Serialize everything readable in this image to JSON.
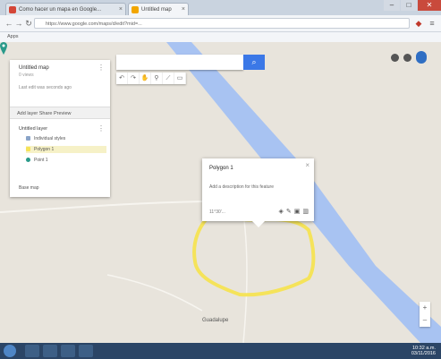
{
  "browser": {
    "tabs": [
      {
        "label": "Como hacer un mapa en Google...",
        "active": false,
        "favicon_color": "#d44638"
      },
      {
        "label": "Untitled map",
        "active": true,
        "favicon_color": "#f2a600"
      }
    ],
    "omnibox_text": "https://www.google.com/maps/d/edit?mid=...",
    "bookmarks_label": "Apps"
  },
  "map": {
    "search_placeholder": "",
    "search_button_icon": "magnifier-icon",
    "draw_tools": [
      "undo-icon",
      "redo-icon",
      "hand-icon",
      "marker-icon",
      "line-icon",
      "ruler-icon"
    ],
    "place_label": "Guadalupe",
    "river_color": "#a8c3f2",
    "boundary_color": "#f5e35a"
  },
  "panel": {
    "title": "Untitled map",
    "subtitle": "0 views",
    "meta": "Last edit was seconds ago",
    "actions": "Add layer   Share   Preview",
    "layer_title": "Untitled layer",
    "layer_rows": [
      {
        "label": "Individual styles",
        "color": "#8aa4c8"
      },
      {
        "label": "Polygon 1",
        "color": "#f5e35a"
      },
      {
        "label": "Point 1",
        "color": "#2a9a8a"
      }
    ],
    "basemap_label": "Base map"
  },
  "popup": {
    "title": "Polygon 1",
    "description": "Add a description for this feature",
    "coords": "11°30'...",
    "icons": [
      "paint-bucket-icon",
      "edit-icon",
      "camera-icon",
      "delete-icon"
    ]
  },
  "taskbar": {
    "time": "10:32 a.m.",
    "date": "03/11/2016"
  }
}
